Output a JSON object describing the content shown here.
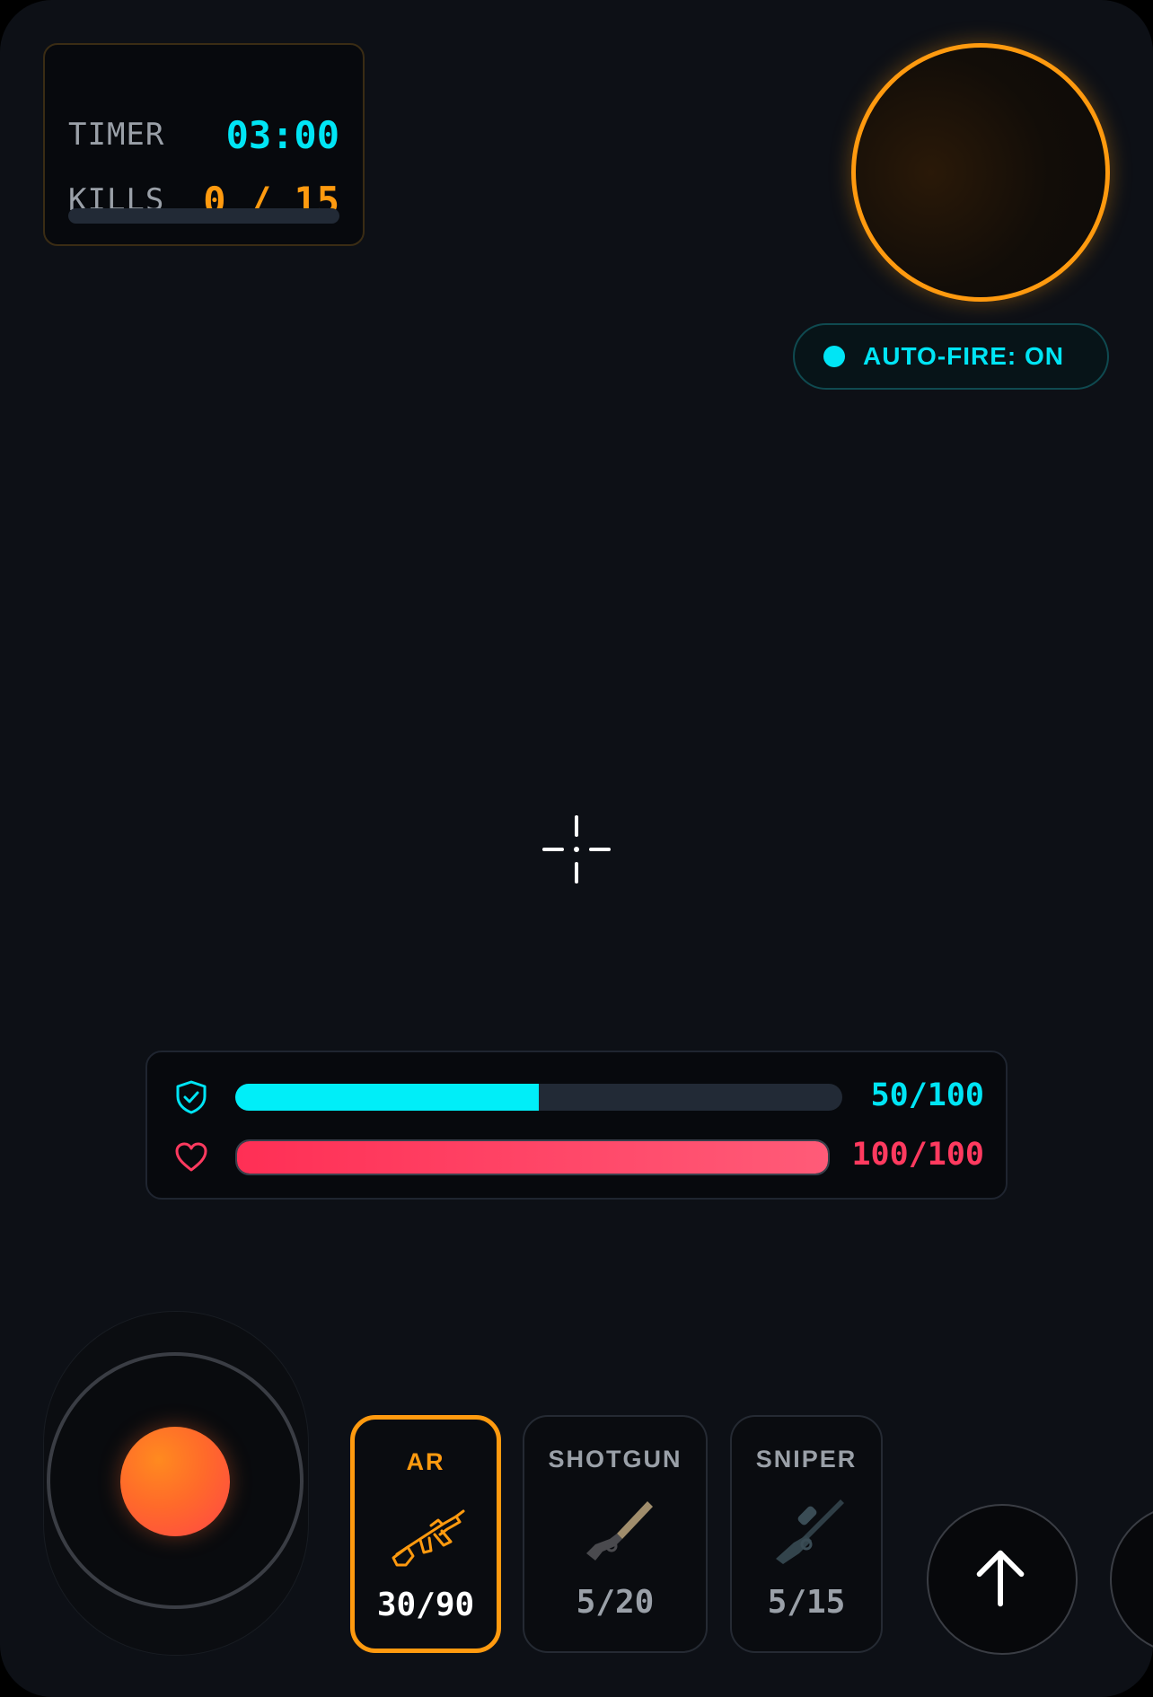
{
  "stats": {
    "timer_label": "TIMER",
    "timer_value": "03:00",
    "kills_label": "KILLS",
    "kills_value": "0 / 15",
    "kills_progress": 0
  },
  "autofire": {
    "label": "AUTO-FIRE: ON",
    "enabled": true
  },
  "vitals": {
    "shield": {
      "text": "50/100",
      "current": 50,
      "max": 100,
      "icon": "shield-check-icon"
    },
    "health": {
      "text": "100/100",
      "current": 100,
      "max": 100,
      "icon": "heart-icon"
    }
  },
  "weapons": [
    {
      "label": "AR",
      "ammo": "30/90",
      "selected": true,
      "icon": "assault-rifle-icon"
    },
    {
      "label": "SHOTGUN",
      "ammo": "5/20",
      "selected": false,
      "icon": "shotgun-icon"
    },
    {
      "label": "SNIPER",
      "ammo": "5/15",
      "selected": false,
      "icon": "sniper-rifle-icon"
    }
  ],
  "controls": {
    "jump_icon": "arrow-up-icon"
  },
  "colors": {
    "accent_orange": "#ff9a0f",
    "accent_cyan": "#00e5f5",
    "health_red": "#ff3a5f",
    "muted_gray": "#9aa0a8"
  }
}
